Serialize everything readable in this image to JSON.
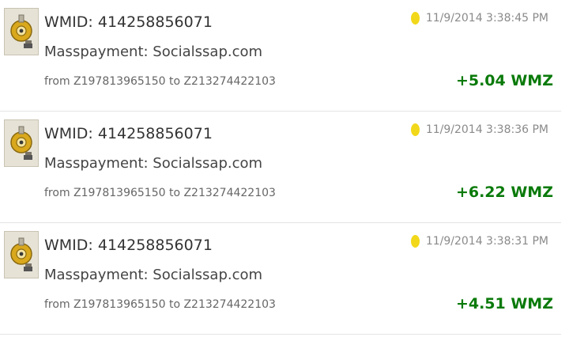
{
  "colors": {
    "amount": "#0a7a0a",
    "status_dot": "#f2d81a",
    "avatar_gold": "#d9a81c"
  },
  "transactions": [
    {
      "wmid_text": "WMID: 414258856071",
      "purpose": "Masspayment: Socialssap.com",
      "route": "from Z197813965150 to Z213274422103",
      "timestamp": "11/9/2014 3:38:45 PM",
      "amount": "+5.04 WMZ",
      "avatar_icon": "webmoney-key-avatar-icon",
      "status_icon": "yellow-status-dot-icon"
    },
    {
      "wmid_text": "WMID: 414258856071",
      "purpose": "Masspayment: Socialssap.com",
      "route": "from Z197813965150 to Z213274422103",
      "timestamp": "11/9/2014 3:38:36 PM",
      "amount": "+6.22 WMZ",
      "avatar_icon": "webmoney-key-avatar-icon",
      "status_icon": "yellow-status-dot-icon"
    },
    {
      "wmid_text": "WMID: 414258856071",
      "purpose": "Masspayment: Socialssap.com",
      "route": "from Z197813965150 to Z213274422103",
      "timestamp": "11/9/2014 3:38:31 PM",
      "amount": "+4.51 WMZ",
      "avatar_icon": "webmoney-key-avatar-icon",
      "status_icon": "yellow-status-dot-icon"
    }
  ]
}
